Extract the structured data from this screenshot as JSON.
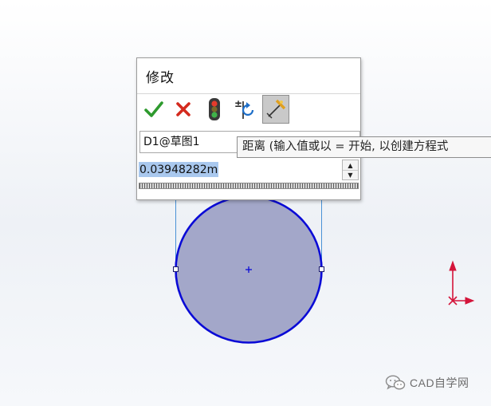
{
  "dialog": {
    "title": "修改",
    "toolbar": [
      {
        "name": "ok-icon",
        "tooltip": ""
      },
      {
        "name": "cancel-icon",
        "tooltip": ""
      },
      {
        "name": "traffic-light-icon",
        "tooltip": ""
      },
      {
        "name": "reverse-dimension-icon",
        "tooltip": ""
      },
      {
        "name": "mark-dimension-icon",
        "tooltip": "",
        "active": true
      }
    ],
    "dimension_name": "D1@草图1",
    "value": "0.03948282m"
  },
  "tooltip": {
    "text": "距离  (输入值或以 = 开始, 以创建方程式"
  },
  "watermark": {
    "text": "CAD自学网"
  },
  "colors": {
    "sketch_line": "#0a0ad6",
    "circle_fill": "#a3a7c9",
    "extension_line": "#4a92d6",
    "axis_red": "#d4143a",
    "ok_green": "#2e9a2e",
    "cancel_red": "#d42a1e",
    "selection": "#a9c8ee"
  }
}
